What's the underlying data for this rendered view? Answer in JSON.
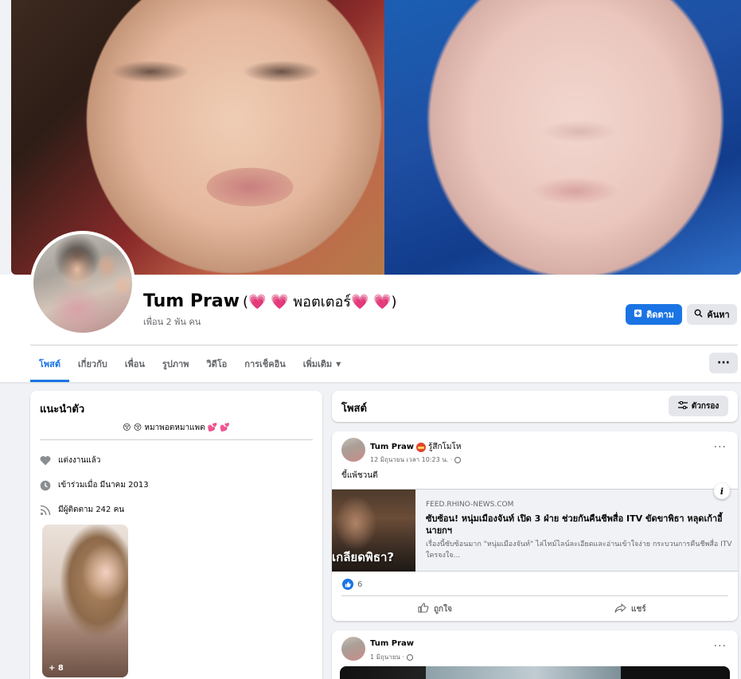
{
  "profile": {
    "name": "Tum Praw",
    "alternate_name": "(💗 💗 พอตเตอร์💗 💗)",
    "friends": "เพื่อน 2 พัน คน",
    "follow_label": "ติดตาม",
    "search_label": "ค้นหา",
    "more_label": "···"
  },
  "tabs": [
    {
      "label": "โพสต์"
    },
    {
      "label": "เกี่ยวกับ"
    },
    {
      "label": "เพื่อน"
    },
    {
      "label": "รูปภาพ"
    },
    {
      "label": "วิดีโอ"
    },
    {
      "label": "การเช็คอิน"
    },
    {
      "label": "เพิ่มเติม"
    }
  ],
  "intro": {
    "title": "แนะนำตัว",
    "bio": "😚 😚 หมาพอตหมาแพต 💕 💕",
    "items": [
      {
        "icon": "heart-icon",
        "text": "แต่งงานแล้ว"
      },
      {
        "icon": "clock-icon",
        "text": "เข้าร่วมเมื่อ มีนาคม 2013"
      },
      {
        "icon": "rss-icon",
        "text": "มีผู้ติดตาม 242 คน"
      }
    ],
    "featured_count": "+ 8"
  },
  "posts_header": {
    "title": "โพสต์",
    "filter_label": "ตัวกรอง"
  },
  "post1": {
    "author": "Tum Praw",
    "feeling": "รู้สึกโมโห",
    "time": "12 มิถุนายน เวลา 10:23 น. ·",
    "text": "ขี้แพ้ชวนตี",
    "link": {
      "thumb_text": "เกลียดพิธา?",
      "domain": "FEED.RHINO-NEWS.COM",
      "title": "ซับซ้อน! หนุ่มเมืองจันท์ เปิด 3 ฝ่าย ช่วยกันคืนชีพสื่อ ITV ขัดขาพิธา หลุดเก้าอี้นายกฯ",
      "description": "เรื่องนี้ซับซ้อนมาก \"หนุ่มเมืองจันท์\" ไล่ไทม์ไลน์ละเอียดและอ่านเข้าใจง่าย กระบวนการคืนชีพสื่อ ITV ใครจงใจ...",
      "info": "i"
    },
    "like_count": "6",
    "like_label": "ถูกใจ",
    "share_label": "แชร์",
    "dots": "···"
  },
  "post2": {
    "author": "Tum Praw",
    "time": "1 มิถุนายน ·",
    "dots": "···"
  },
  "colors": {
    "accent": "#1b74e4",
    "page_bg": "#f0f2f5",
    "secondary_text": "#65676b"
  }
}
